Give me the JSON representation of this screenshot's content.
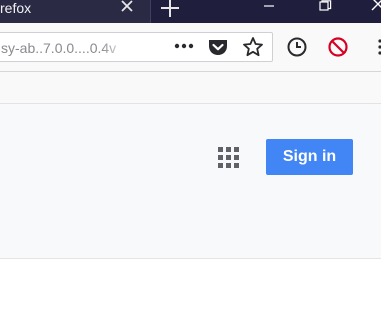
{
  "browser": {
    "tab_title": "refox",
    "tab_close_icon": "close-icon",
    "new_tab_icon": "plus-icon",
    "url_text": "sy-ab..7.0.0....0.4v",
    "toolbar_icons": [
      "more-actions-icon",
      "pocket-icon",
      "bookmark-star-icon",
      "history-clock-icon",
      "block-icon",
      "overflow-menu-icon"
    ],
    "window_controls": [
      "minimize-icon",
      "maximize-icon",
      "close-icon"
    ]
  },
  "page": {
    "apps_icon": "apps-grid-icon",
    "signin_label": "Sign in",
    "colors": {
      "signin_blue": "#4285f4",
      "block_red": "#d70022",
      "titlebar": "#1f1e3c"
    }
  }
}
